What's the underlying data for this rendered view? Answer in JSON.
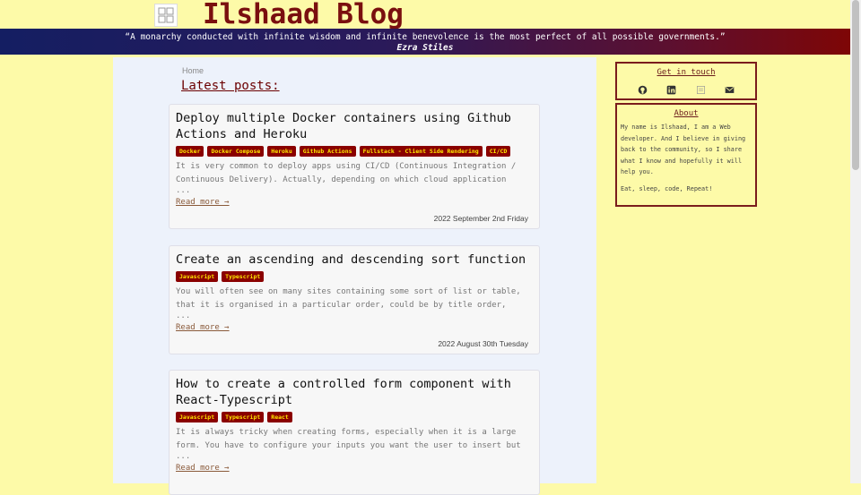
{
  "site": {
    "title": "Ilshaad Blog",
    "quote": "“A monarchy conducted with infinite wisdom and infinite benevolence is the most perfect of all possible governments.”",
    "quote_author": "Ezra Stiles"
  },
  "breadcrumb": "Home",
  "heading": "Latest posts:",
  "posts": [
    {
      "title": "Deploy multiple Docker containers using Github Actions and Heroku",
      "tags": [
        "Docker",
        "Docker Compose",
        "Heroku",
        "Github Actions",
        "Fullstack - Client Side Rendering",
        "CI/CD"
      ],
      "excerpt": "It is very common to deploy apps using CI/CD (Continuous Integration / Continuous Delivery). Actually, depending on which cloud application",
      "ellipsis": "...",
      "read_more": "Read more →",
      "date": "2022 September 2nd Friday"
    },
    {
      "title": "Create an ascending and descending sort function",
      "tags": [
        "Javascript",
        "Typescript"
      ],
      "excerpt": "You will often see on many sites containing some sort of list or table, that it is organised in a particular order, could be by title order,",
      "ellipsis": "...",
      "read_more": "Read more →",
      "date": "2022 August 30th Tuesday"
    },
    {
      "title": "How to create a controlled form component with React-Typescript",
      "tags": [
        "Javascript",
        "Typescript",
        "React"
      ],
      "excerpt": "It is always tricky when creating forms, especially when it is a large form. You have to configure your inputs you want the user to insert but",
      "ellipsis": "...",
      "read_more": "Read more →",
      "date": ""
    }
  ],
  "sidebar": {
    "contact_title": "Get in touch",
    "social_icons": [
      "github-icon",
      "linkedin-icon",
      "resume-icon",
      "email-icon"
    ],
    "about_title": "About",
    "about_text": "My name is Ilshaad, I am a Web developer. And I believe in giving back to the community, so I share what I know and hopefully it will help you.",
    "about_motto": "Eat, sleep, code, Repeat!"
  },
  "colors": {
    "background": "#fdfaa8",
    "brand": "#7a0f0f",
    "tag_bg": "#8a0000",
    "tag_text": "#ffe800"
  }
}
